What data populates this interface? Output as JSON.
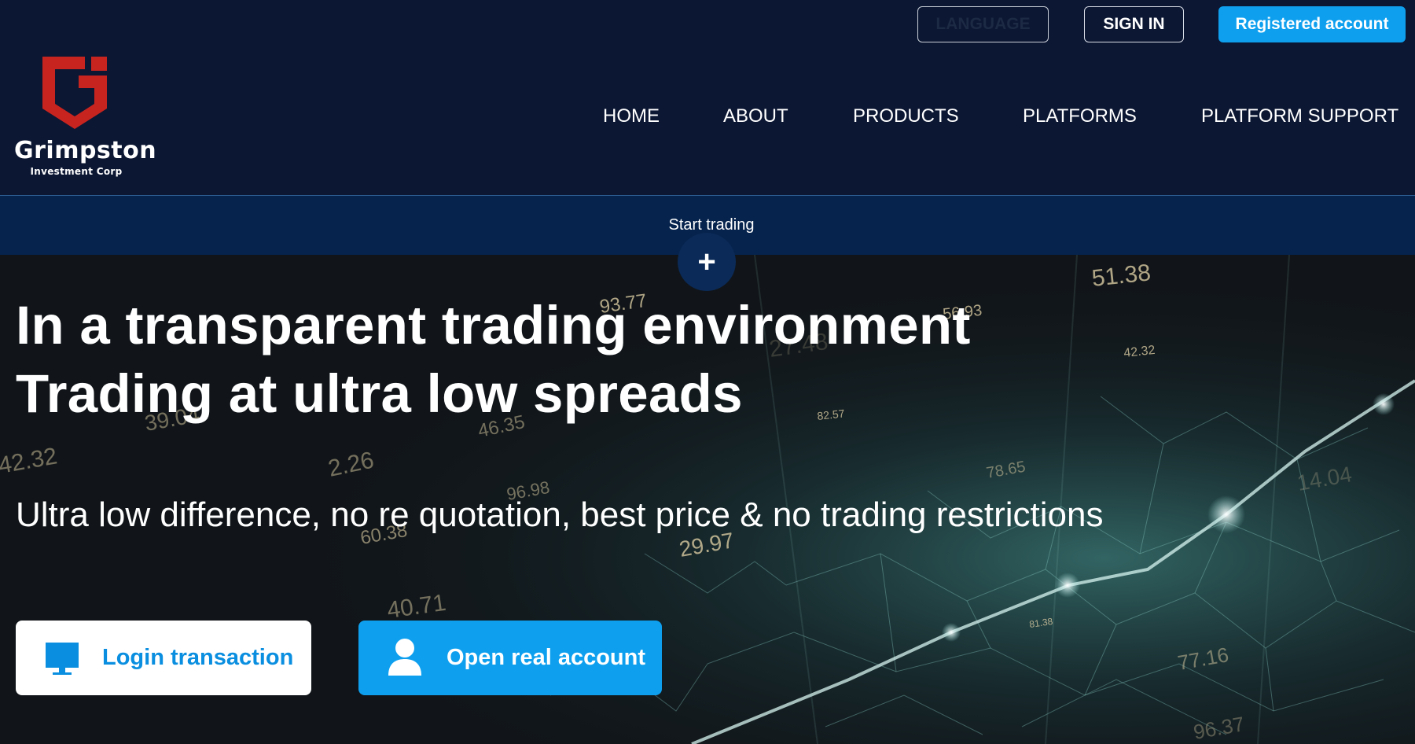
{
  "brand": {
    "name": "Grimpston",
    "tagline": "Investment Corp",
    "colors": {
      "logo_red": "#c8241f",
      "accent_blue": "#0ea0ef",
      "header_bg": "#0c1733"
    }
  },
  "top_buttons": {
    "language": "LANGUAGE",
    "sign_in": "SIGN IN",
    "register": "Registered account"
  },
  "nav": {
    "items": [
      {
        "label": "HOME"
      },
      {
        "label": "ABOUT"
      },
      {
        "label": "PRODUCTS"
      },
      {
        "label": "PLATFORMS"
      },
      {
        "label": "PLATFORM SUPPORT"
      }
    ]
  },
  "band": {
    "label": "Start trading",
    "toggle_icon": "plus-icon"
  },
  "hero": {
    "title_line1": "In a transparent trading environment",
    "title_line2": "Trading at ultra low spreads",
    "subtitle": "Ultra low difference, no re quotation, best price & no trading restrictions",
    "login_button": {
      "label": "Login transaction",
      "icon": "monitor-icon"
    },
    "open_button": {
      "label": "Open real account",
      "icon": "user-icon"
    },
    "background_figures": [
      "93.77",
      "51.38",
      "56.93",
      "42.32",
      "82.57",
      "78.65",
      "39.04",
      "46.35",
      "2.26",
      "42.32",
      "60.38",
      "29.97",
      "77.16",
      "40.71",
      "96.37",
      "14.04",
      "27.48",
      "81.38",
      "96.98"
    ]
  }
}
